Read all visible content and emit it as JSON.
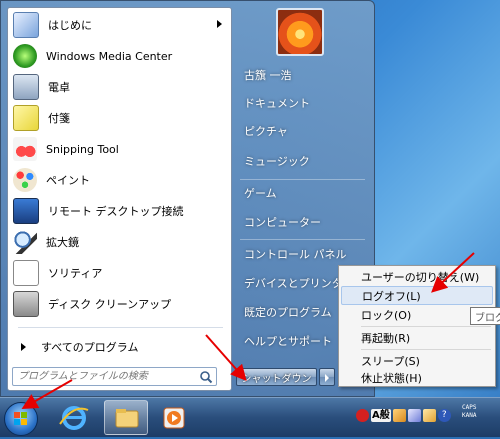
{
  "start_menu": {
    "programs": [
      {
        "label": "はじめに",
        "icon": "getting-started-icon",
        "has_submenu": true
      },
      {
        "label": "Windows Media Center",
        "icon": "windows-media-center-icon",
        "has_submenu": false
      },
      {
        "label": "電卓",
        "icon": "calculator-icon",
        "has_submenu": false
      },
      {
        "label": "付箋",
        "icon": "sticky-notes-icon",
        "has_submenu": false
      },
      {
        "label": "Snipping Tool",
        "icon": "snipping-tool-icon",
        "has_submenu": false
      },
      {
        "label": "ペイント",
        "icon": "paint-icon",
        "has_submenu": false
      },
      {
        "label": "リモート デスクトップ接続",
        "icon": "remote-desktop-icon",
        "has_submenu": false
      },
      {
        "label": "拡大鏡",
        "icon": "magnifier-icon",
        "has_submenu": false
      },
      {
        "label": "ソリティア",
        "icon": "solitaire-icon",
        "has_submenu": false
      },
      {
        "label": "ディスク クリーンアップ",
        "icon": "disk-cleanup-icon",
        "has_submenu": false
      }
    ],
    "all_programs": "すべてのプログラム",
    "search_placeholder": "プログラムとファイルの検索",
    "right_items": [
      "古籏 一浩",
      "ドキュメント",
      "ピクチャ",
      "ミュージック",
      "ゲーム",
      "コンピューター",
      "コントロール パネル",
      "デバイスとプリンター",
      "既定のプログラム",
      "ヘルプとサポート"
    ],
    "shutdown_label": "シャットダウン"
  },
  "power_submenu": {
    "items": [
      {
        "label": "ユーザーの切り替え(W)",
        "highlighted": false
      },
      {
        "label": "ログオフ(L)",
        "highlighted": true
      },
      {
        "label": "ロック(O)",
        "highlighted": false
      },
      {
        "label": "再起動(R)",
        "highlighted": false
      },
      {
        "label": "スリープ(S)",
        "highlighted": false
      },
      {
        "label": "休止状態(H)",
        "highlighted": false
      }
    ]
  },
  "tooltip": {
    "text": "ブログ"
  },
  "taskbar": {
    "pinned": [
      "internet-explorer-icon",
      "windows-explorer-icon",
      "media-player-icon"
    ],
    "ime_mode": "A",
    "ime_kanji": "般",
    "caps": "CAPS",
    "kana": "KANA"
  },
  "colors": {
    "highlight": "#dfe9f6",
    "annotation_arrow": "#e60000",
    "taskbar": "#2a4e7c"
  }
}
